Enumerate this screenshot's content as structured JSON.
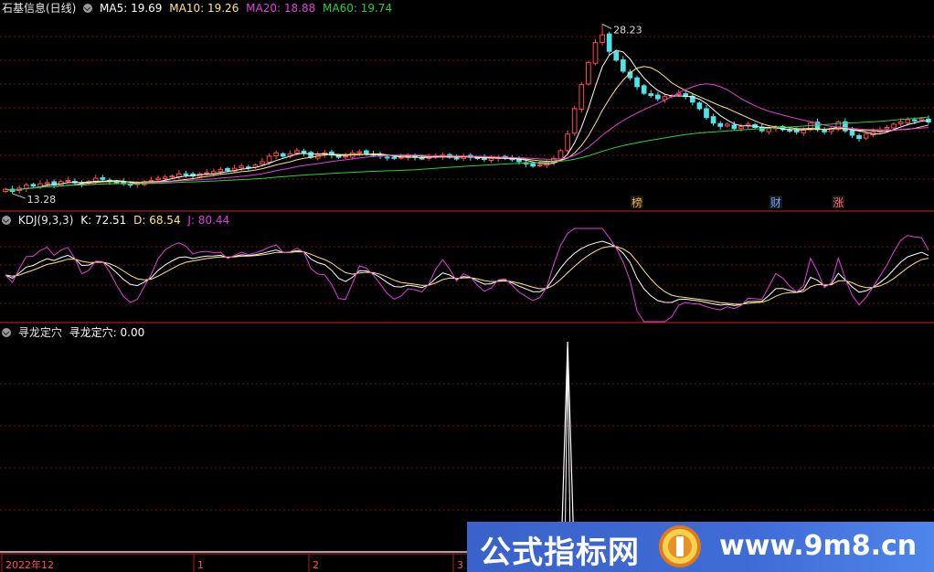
{
  "main_header": {
    "title": "石基信息(日线)",
    "ma5_label": "MA5: 19.69",
    "ma10_label": "MA10: 19.26",
    "ma20_label": "MA20: 18.88",
    "ma60_label": "MA60: 19.74"
  },
  "kdj_header": {
    "title": "KDJ(9,3,3)",
    "k_label": "K: 72.51",
    "d_label": "D: 68.54",
    "j_label": "J: 80.44"
  },
  "ind_header": {
    "title": "寻龙定穴",
    "value_label": "寻龙定穴: 0.00"
  },
  "colors": {
    "up": "#ff4a4a",
    "down": "#4fe3e8",
    "ma5": "#ffffff",
    "ma10": "#ffe67a",
    "ma20": "#e040e0",
    "ma60": "#28d040",
    "grid": "#7a1010",
    "axis": "#b01818",
    "watermark_bg": "#3f6bd6"
  },
  "watermark": {
    "left_text": "公式指标网",
    "right_text": "www.9m8.cn"
  },
  "chart_data": [
    {
      "type": "candlestick",
      "title": "石基信息(日线)",
      "annotations": [
        {
          "text": "28.23",
          "kind": "high"
        },
        {
          "text": "13.28",
          "kind": "low"
        }
      ],
      "event_tags": [
        "榜",
        "财",
        "涨"
      ],
      "x_labels": [
        "2022年12",
        "1",
        "2",
        "3"
      ],
      "series": [
        {
          "name": "MA5",
          "value": 19.69
        },
        {
          "name": "MA10",
          "value": 19.26
        },
        {
          "name": "MA20",
          "value": 18.88
        },
        {
          "name": "MA60",
          "value": 19.74
        }
      ],
      "close": [
        13.5,
        13.3,
        13.6,
        13.9,
        13.8,
        14.0,
        14.1,
        13.9,
        14.2,
        14.3,
        14.1,
        14.0,
        14.2,
        14.5,
        14.4,
        14.2,
        14.1,
        14.0,
        13.9,
        14.0,
        14.2,
        14.3,
        14.5,
        14.6,
        14.7,
        14.9,
        14.8,
        14.7,
        14.9,
        15.0,
        15.1,
        15.3,
        15.2,
        15.4,
        15.6,
        15.5,
        15.7,
        16.0,
        16.5,
        16.8,
        16.5,
        16.7,
        17.0,
        16.8,
        16.4,
        16.6,
        16.8,
        16.6,
        16.4,
        16.5,
        16.8,
        16.9,
        16.7,
        16.6,
        16.5,
        16.4,
        16.3,
        16.4,
        16.5,
        16.4,
        16.3,
        16.4,
        16.5,
        16.6,
        16.4,
        16.3,
        16.5,
        16.4,
        16.3,
        16.2,
        16.3,
        16.4,
        16.3,
        16.2,
        16.0,
        15.8,
        15.6,
        15.7,
        15.9,
        16.3,
        17.0,
        18.5,
        20.8,
        23.0,
        25.0,
        26.8,
        27.5,
        26.0,
        25.2,
        24.2,
        23.6,
        22.8,
        22.2,
        22.0,
        21.7,
        21.9,
        22.0,
        22.2,
        21.9,
        21.4,
        20.8,
        20.0,
        19.5,
        19.2,
        19.4,
        19.0,
        19.2,
        19.4,
        19.1,
        18.8,
        19.0,
        19.1,
        18.9,
        18.8,
        18.7,
        18.9,
        19.5,
        18.9,
        18.7,
        19.0,
        19.6,
        18.8,
        18.4,
        18.1,
        18.5,
        18.7,
        18.9,
        19.1,
        19.4,
        19.6,
        19.8,
        19.7,
        19.9,
        19.6
      ]
    },
    {
      "type": "line",
      "title": "KDJ(9,3,3)",
      "series": [
        {
          "name": "K",
          "value": 72.51
        },
        {
          "name": "D",
          "value": 68.54
        },
        {
          "name": "J",
          "value": 80.44
        }
      ]
    },
    {
      "type": "line",
      "title": "寻龙定穴",
      "series": [
        {
          "name": "寻龙定穴",
          "value": 0.0
        }
      ]
    }
  ]
}
